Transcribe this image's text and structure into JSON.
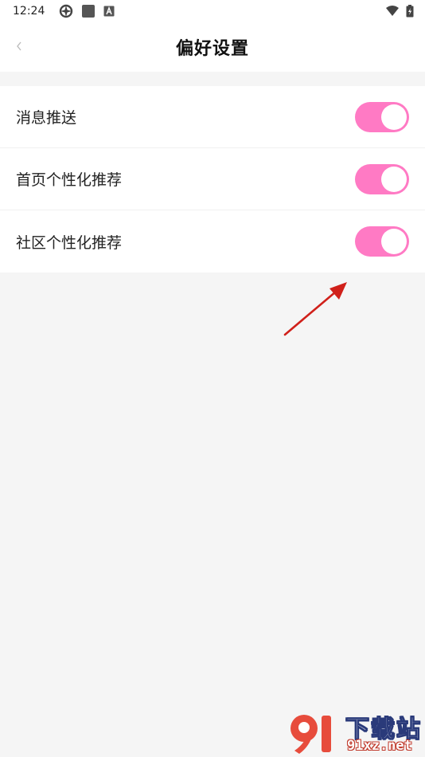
{
  "status_bar": {
    "time": "12:24",
    "left_icons": [
      "sync-icon",
      "app-square-icon",
      "a-box-icon"
    ],
    "right_icons": [
      "wifi-icon",
      "battery-icon"
    ]
  },
  "nav": {
    "back_icon": "chevron-left-icon",
    "title": "偏好设置"
  },
  "settings": {
    "items": [
      {
        "label": "消息推送",
        "enabled": true
      },
      {
        "label": "首页个性化推荐",
        "enabled": true
      },
      {
        "label": "社区个性化推荐",
        "enabled": true
      }
    ]
  },
  "watermark": {
    "logo": "91-logo",
    "title": "下载站",
    "domain": "91xz.net"
  },
  "colors": {
    "toggle_on": "#ff7ac4",
    "background": "#f5f5f5",
    "annotation_arrow": "#d0201a"
  }
}
